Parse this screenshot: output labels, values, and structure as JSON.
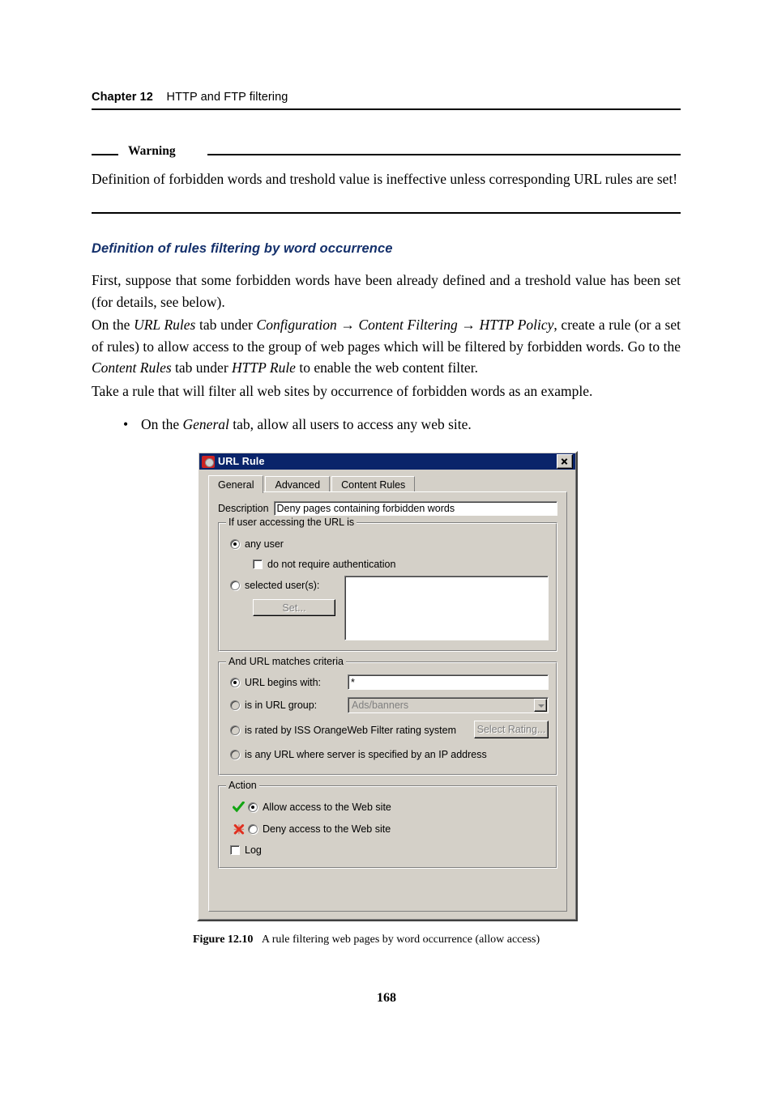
{
  "running_head": {
    "chapter": "Chapter 12",
    "title": "HTTP and FTP filtering"
  },
  "warning": {
    "label": "Warning",
    "body": "Definition of forbidden words and treshold value is ineffective unless corresponding URL rules are set!"
  },
  "section": {
    "heading": "Definition of rules filtering by word occurrence"
  },
  "paragraphs": {
    "p1_a": "First, suppose that some forbidden words have been already defined and a treshold value has been set (for details, see below).",
    "p2_a": "On the ",
    "p2_i1": "URL Rules",
    "p2_b": " tab under ",
    "p2_i2": "Configuration",
    "p2_arrow1": " → ",
    "p2_i3": "Content Filtering",
    "p2_arrow2": " → ",
    "p2_i4": "HTTP Policy",
    "p2_c": ", create a rule (or a set of rules) to allow access to the group of web pages which will be filtered by forbidden words. Go to the ",
    "p2_i5": "Content Rules",
    "p2_d": " tab under ",
    "p2_i6": "HTTP Rule",
    "p2_e": " to enable the web content filter.",
    "p3_a": "Take a rule that will filter all web sites by occurrence of forbidden words as an example.",
    "bullet_dot": "•",
    "bullet_a": "On the ",
    "bullet_i": "General",
    "bullet_b": " tab, allow all users to access any web site."
  },
  "dialog": {
    "title": "URL Rule",
    "icon": "url-rule-icon",
    "close_label": "×",
    "tabs": [
      {
        "label": "General",
        "active": true
      },
      {
        "label": "Advanced",
        "active": false
      },
      {
        "label": "Content Rules",
        "active": false
      }
    ],
    "description": {
      "label": "Description",
      "value": "Deny pages containing forbidden words",
      "placeholder": ""
    },
    "user_group": {
      "title": "If user accessing the URL is",
      "any_user": {
        "label": "any user",
        "selected": true
      },
      "no_auth": {
        "label": "do not require authentication",
        "checked": false
      },
      "selected_users": {
        "label": "selected user(s):",
        "selected": false
      },
      "set_button": {
        "label": "Set...",
        "enabled": false
      },
      "list_value": ""
    },
    "url_group": {
      "title": "And URL matches criteria",
      "begins_with": {
        "label": "URL begins with:",
        "selected": true,
        "value": "*"
      },
      "in_url_group": {
        "label": "is in URL group:",
        "selected": false,
        "value": "Ads/banners",
        "enabled": false
      },
      "rated_by": {
        "label": "is rated by ISS OrangeWeb Filter rating system",
        "selected": false
      },
      "select_rating_button": {
        "label": "Select Rating...",
        "enabled": false
      },
      "any_url_ip": {
        "label": "is any URL where server is specified by an IP address",
        "selected": false
      }
    },
    "action_group": {
      "title": "Action",
      "allow": {
        "label": "Allow access to the Web site",
        "selected": true,
        "icon": "green-check-icon"
      },
      "deny": {
        "label": "Deny access to the Web site",
        "selected": false,
        "icon": "red-x-icon"
      },
      "log": {
        "label": "Log",
        "checked": false
      }
    },
    "colors": {
      "titlebar": "#0a246a",
      "face": "#d4d0c8",
      "allow_icon": "#13a513",
      "deny_icon": "#e03020"
    }
  },
  "figure": {
    "number": "Figure 12.10",
    "caption": "A rule filtering web pages by word occurrence (allow access)"
  },
  "folio": {
    "page_number": "168"
  }
}
